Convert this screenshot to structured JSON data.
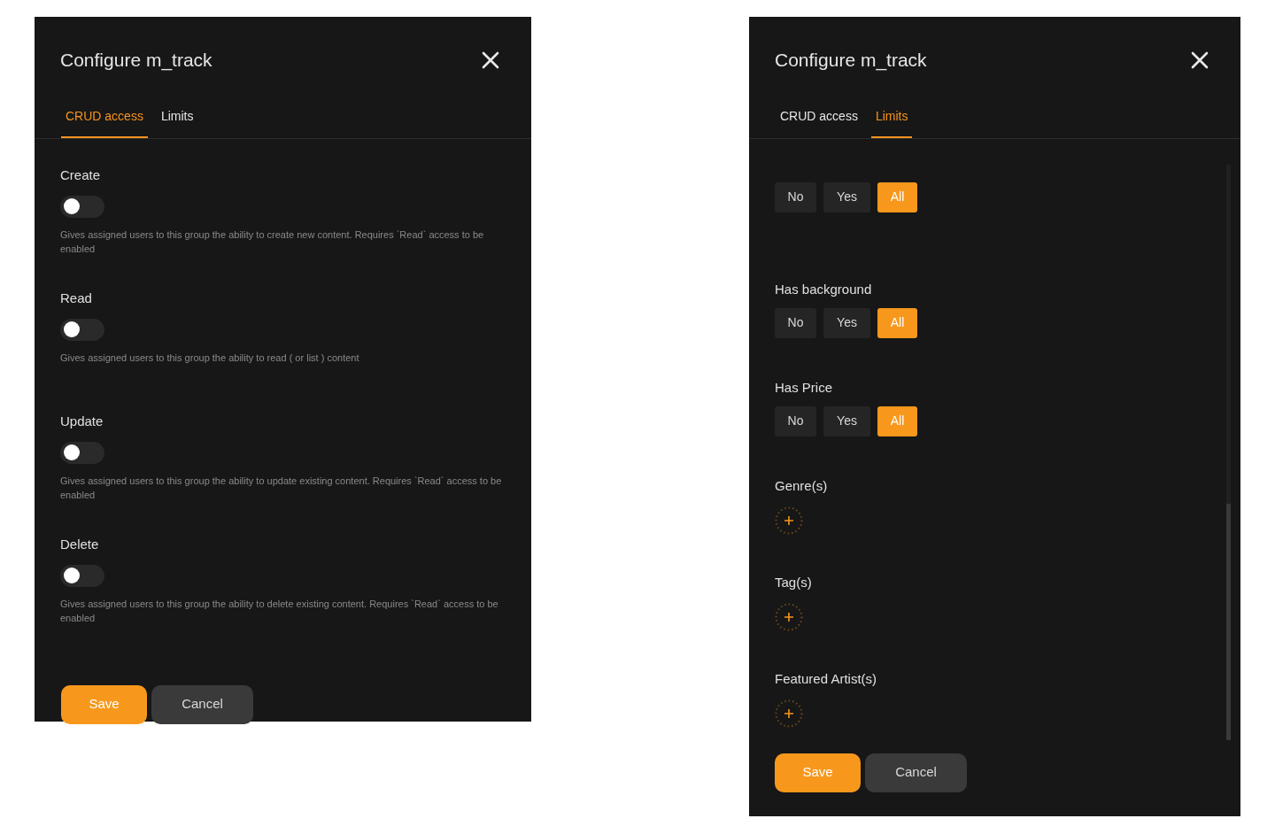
{
  "dialogs": [
    {
      "kind": "crud",
      "title": "Configure m_track",
      "tabs": [
        {
          "label": "CRUD access",
          "selected": true
        },
        {
          "label": "Limits",
          "selected": false
        }
      ],
      "permissions": [
        {
          "label": "Create",
          "on": false,
          "description": "Gives assigned users to this group the ability to create new content. Requires `Read` access to be enabled"
        },
        {
          "label": "Read",
          "on": false,
          "description": "Gives assigned users to this group the ability to read ( or list ) content"
        },
        {
          "label": "Update",
          "on": false,
          "description": "Gives assigned users to this group the ability to update existing content. Requires `Read` access to be enabled"
        },
        {
          "label": "Delete",
          "on": false,
          "description": "Gives assigned users to this group the ability to delete existing content. Requires `Read` access to be enabled"
        }
      ],
      "buttons": [
        {
          "label": "Save",
          "kind": "primary"
        },
        {
          "label": "Cancel",
          "kind": "secondary"
        }
      ]
    },
    {
      "kind": "limits",
      "title": "Configure m_track",
      "tabs": [
        {
          "label": "CRUD access",
          "selected": false
        },
        {
          "label": "Limits",
          "selected": true
        }
      ],
      "filters": [
        {
          "options": [
            {
              "label": "No",
              "selected": false
            },
            {
              "label": "Yes",
              "selected": false
            },
            {
              "label": "All",
              "selected": true
            }
          ]
        },
        {
          "label": "Has background",
          "options": [
            {
              "label": "No",
              "selected": false
            },
            {
              "label": "Yes",
              "selected": false
            },
            {
              "label": "All",
              "selected": true
            }
          ]
        },
        {
          "label": "Has Price",
          "options": [
            {
              "label": "No",
              "selected": false
            },
            {
              "label": "Yes",
              "selected": false
            },
            {
              "label": "All",
              "selected": true
            }
          ]
        }
      ],
      "pickers": [
        {
          "label": "Genre(s)"
        },
        {
          "label": "Tag(s)"
        },
        {
          "label": "Featured Artist(s)"
        }
      ],
      "buttons": [
        {
          "label": "Save",
          "kind": "primary"
        },
        {
          "label": "Cancel",
          "kind": "secondary"
        }
      ]
    }
  ]
}
